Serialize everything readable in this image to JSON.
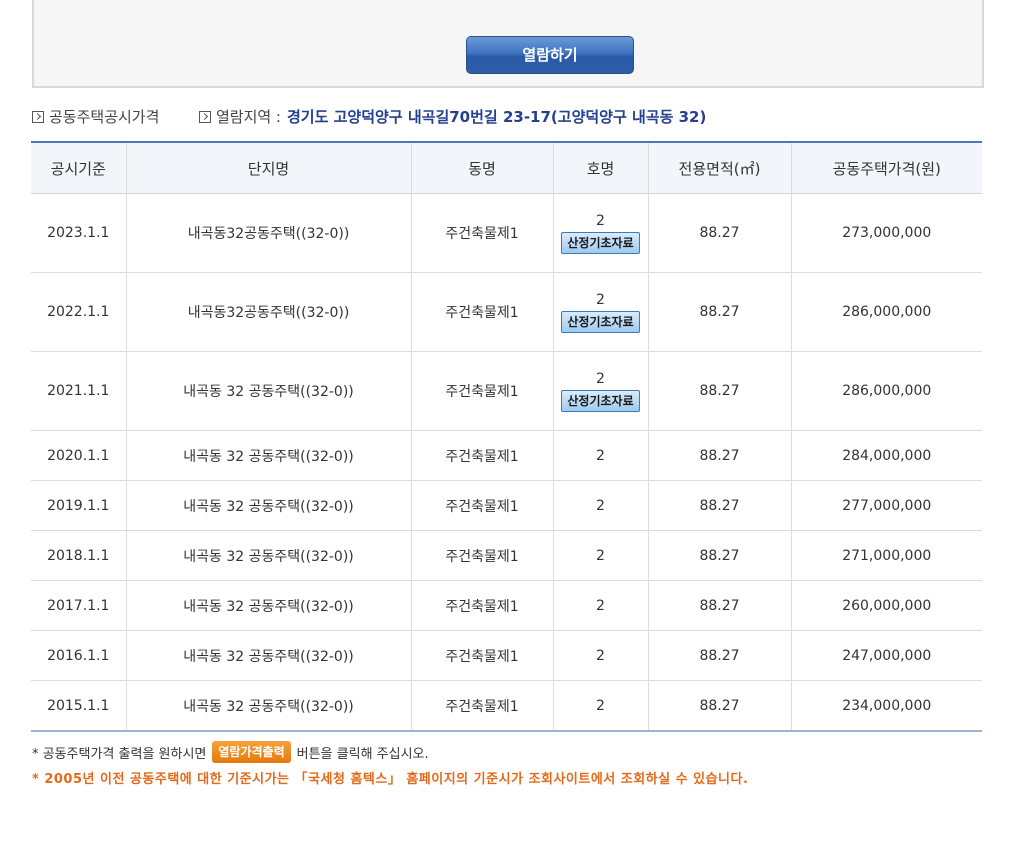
{
  "search": {
    "view_button": "열람하기"
  },
  "info": {
    "section_label": "공동주택공시가격",
    "region_label": "열람지역 :",
    "region_value": "경기도 고양덕양구 내곡길70번길 23-17(고양덕양구 내곡동 32)"
  },
  "table": {
    "headers": [
      "공시기준",
      "단지명",
      "동명",
      "호명",
      "전용면적(㎡)",
      "공동주택가격(원)"
    ],
    "basis_button_label": "산정기초자료",
    "rows": [
      {
        "date": "2023.1.1",
        "complex": "내곡동32공동주택((32-0))",
        "dong": "주건축물제1",
        "ho": "2",
        "area": "88.27",
        "price": "273,000,000",
        "basis": true
      },
      {
        "date": "2022.1.1",
        "complex": "내곡동32공동주택((32-0))",
        "dong": "주건축물제1",
        "ho": "2",
        "area": "88.27",
        "price": "286,000,000",
        "basis": true
      },
      {
        "date": "2021.1.1",
        "complex": "내곡동 32 공동주택((32-0))",
        "dong": "주건축물제1",
        "ho": "2",
        "area": "88.27",
        "price": "286,000,000",
        "basis": true
      },
      {
        "date": "2020.1.1",
        "complex": "내곡동 32 공동주택((32-0))",
        "dong": "주건축물제1",
        "ho": "2",
        "area": "88.27",
        "price": "284,000,000",
        "basis": false
      },
      {
        "date": "2019.1.1",
        "complex": "내곡동 32 공동주택((32-0))",
        "dong": "주건축물제1",
        "ho": "2",
        "area": "88.27",
        "price": "277,000,000",
        "basis": false
      },
      {
        "date": "2018.1.1",
        "complex": "내곡동 32 공동주택((32-0))",
        "dong": "주건축물제1",
        "ho": "2",
        "area": "88.27",
        "price": "271,000,000",
        "basis": false
      },
      {
        "date": "2017.1.1",
        "complex": "내곡동 32 공동주택((32-0))",
        "dong": "주건축물제1",
        "ho": "2",
        "area": "88.27",
        "price": "260,000,000",
        "basis": false
      },
      {
        "date": "2016.1.1",
        "complex": "내곡동 32 공동주택((32-0))",
        "dong": "주건축물제1",
        "ho": "2",
        "area": "88.27",
        "price": "247,000,000",
        "basis": false
      },
      {
        "date": "2015.1.1",
        "complex": "내곡동 32 공동주택((32-0))",
        "dong": "주건축물제1",
        "ho": "2",
        "area": "88.27",
        "price": "234,000,000",
        "basis": false
      }
    ]
  },
  "notes": {
    "note1_before": "* 공동주택가격 출력을 원하시면",
    "print_button": "열람가격출력",
    "note1_after": "버튼을 클릭해 주십시오.",
    "note2": "* 2005년 이전 공동주택에 대한 기준시가는 「국세청 홈텍스」 홈페이지의 기준시가 조회사이트에서 조회하실 수 있습니다."
  }
}
